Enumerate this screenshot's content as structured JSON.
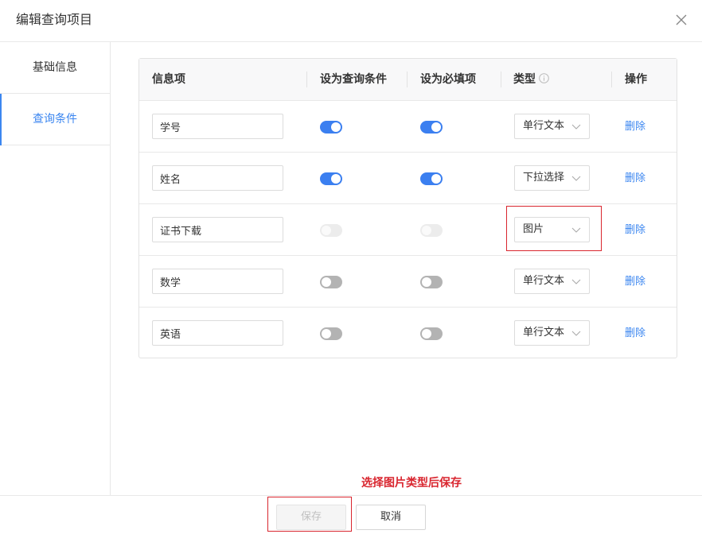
{
  "dialog": {
    "title": "编辑查询项目"
  },
  "sidebar": {
    "items": [
      {
        "label": "基础信息",
        "active": false
      },
      {
        "label": "查询条件",
        "active": true
      }
    ]
  },
  "table": {
    "headers": {
      "name": "信息项",
      "query": "设为查询条件",
      "required": "设为必填项",
      "type": "类型",
      "action": "操作"
    },
    "rows": [
      {
        "name": "学号",
        "query": "on",
        "required": "on",
        "type": "单行文本",
        "action": "删除"
      },
      {
        "name": "姓名",
        "query": "on",
        "required": "on",
        "type": "下拉选择",
        "action": "删除"
      },
      {
        "name": "证书下载",
        "query": "disabled",
        "required": "disabled",
        "type": "图片",
        "action": "删除"
      },
      {
        "name": "数学",
        "query": "off",
        "required": "off",
        "type": "单行文本",
        "action": "删除"
      },
      {
        "name": "英语",
        "query": "off",
        "required": "off",
        "type": "单行文本",
        "action": "删除"
      }
    ]
  },
  "annotation": {
    "text": "选择图片类型后保存",
    "color": "#d9262f"
  },
  "footer": {
    "save_label": "保存",
    "cancel_label": "取消"
  },
  "colors": {
    "accent": "#3b86f0",
    "toggle_on": "#3b7ff0",
    "toggle_off": "#b3b3b3",
    "toggle_disabled": "#ececec"
  },
  "icons": {
    "close": "close-icon",
    "info": "info-icon",
    "dropdown": "chevron-down-icon"
  }
}
